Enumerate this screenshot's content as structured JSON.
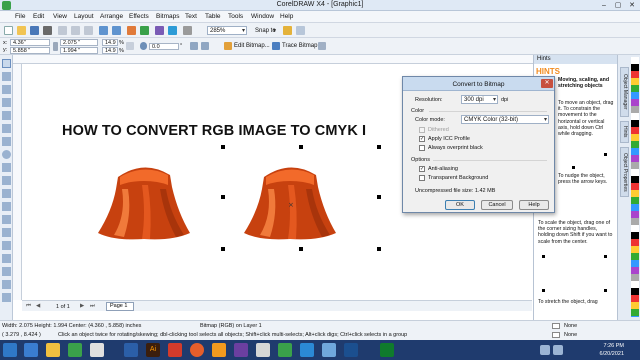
{
  "window": {
    "title": "CorelDRAW X4 - [Graphic1]",
    "minimize": "–",
    "maximize": "▢",
    "close": "✕"
  },
  "menu": [
    "File",
    "Edit",
    "View",
    "Layout",
    "Arrange",
    "Effects",
    "Bitmaps",
    "Text",
    "Table",
    "Tools",
    "Window",
    "Help"
  ],
  "toolbar": {
    "zoom": "285%",
    "snap_to": "Snap to"
  },
  "propbar": {
    "x": "4.36\"",
    "y": "5.858 \"",
    "w": "2.075 \"",
    "h": "1.994 \"",
    "scale_w": "14.9",
    "scale_h": "14.9",
    "pct": "%",
    "rotation": "0.0",
    "deg": "°",
    "edit_bitmap": "Edit Bitmap...",
    "trace_bitmap": "Trace Bitmap"
  },
  "canvas": {
    "headline": "HOW TO CONVERT RGB IMAGE TO CMYK I"
  },
  "page_tabs": {
    "counter": "1 of 1",
    "page": "Page 1"
  },
  "status": {
    "line1": "Width: 2.075  Height: 1.994  Center: (4.360 , 5.858)  inches",
    "line1b": "Bitmap (RGB) on Layer 1",
    "line2": "( 3.279 , 8.424 )",
    "line2b": "Click an object twice for rotating/skewing; dbl-clicking tool selects all objects; Shift+click multi-selects; Alt+click digs; Ctrl+click selects in a group",
    "fill": "None",
    "outline": "None"
  },
  "dialog": {
    "title": "Convert to Bitmap",
    "resolution_label": "Resolution:",
    "resolution_value": "300 dpi",
    "resolution_unit": "dpi",
    "color_section": "Color",
    "color_mode_label": "Color mode:",
    "color_mode_value": "CMYK Color (32-bit)",
    "dithered": "Dithered",
    "apply_icc": "Apply ICC Profile",
    "overprint": "Always overprint black",
    "options_section": "Options",
    "anti_aliasing": "Anti-aliasing",
    "transparent_bg": "Transparent Background",
    "file_size": "Uncompressed file size: 1.42 MB",
    "ok": "OK",
    "cancel": "Cancel",
    "help": "Help"
  },
  "hints": {
    "header": "Hints",
    "brand": "HINTS",
    "heading": "Moving, scaling, and stretching objects",
    "p1": "To move an object, drag it. To constrain the movement to the horizontal or vertical axis, hold down Ctrl while dragging.",
    "p2": "To nudge the object, press the arrow keys.",
    "p3": "To scale the object, drag one of the corner sizing handles, holding down Shift if you want to scale from the center.",
    "p4": "To stretch the object, drag",
    "tabs": [
      "Object Manager",
      "Hints",
      "Object Properties"
    ]
  },
  "taskbar": {
    "time": "7:26 PM",
    "date": "6/20/2021"
  },
  "colors": {
    "title_bg": "#dfe9f5",
    "taskbar": "#1f3b6e",
    "cloth": "#e0521c",
    "hints_brand": "#f28b1e"
  }
}
